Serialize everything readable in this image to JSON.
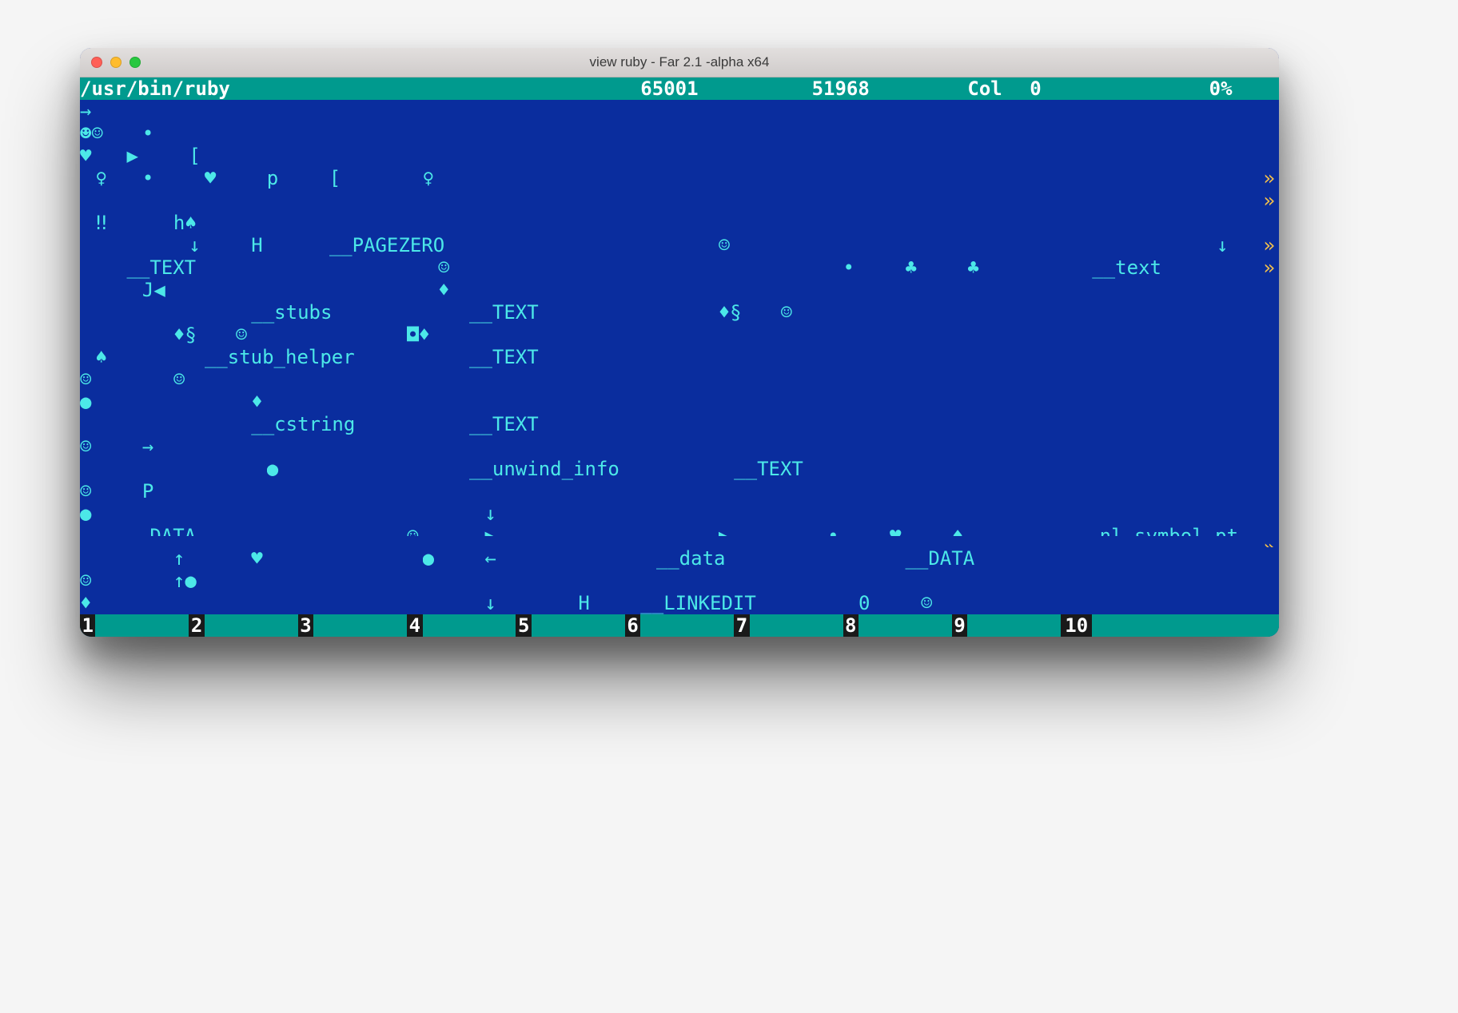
{
  "titlebar": {
    "title": "view ruby - Far 2.1 -alpha x64"
  },
  "header": {
    "path": "/usr/bin/ruby",
    "codepage": "65001",
    "filesize": "51968",
    "col_label": "Col",
    "col_value": "0",
    "percent": "0%"
  },
  "rows": [
    {
      "cells": [
        {
          "c": 0,
          "t": "→"
        }
      ]
    },
    {
      "cells": [
        {
          "c": 0,
          "t": "☻☺"
        },
        {
          "c": 4,
          "t": "•"
        }
      ]
    },
    {
      "cells": [
        {
          "c": 0,
          "t": "♥"
        },
        {
          "c": 3,
          "t": "▶"
        },
        {
          "c": 7,
          "t": "["
        }
      ]
    },
    {
      "cells": [
        {
          "c": 1,
          "t": "♀"
        },
        {
          "c": 4,
          "t": "•"
        },
        {
          "c": 8,
          "t": "♥"
        },
        {
          "c": 12,
          "t": "p"
        },
        {
          "c": 16,
          "t": "["
        },
        {
          "c": 22,
          "t": "♀"
        },
        {
          "c": 76,
          "t": "»",
          "cls": "yellow"
        }
      ]
    },
    {
      "cells": [
        {
          "c": 76,
          "t": "»",
          "cls": "yellow"
        }
      ]
    },
    {
      "cells": [
        {
          "c": 1,
          "t": "‼"
        },
        {
          "c": 6,
          "t": "h♠"
        }
      ]
    },
    {
      "cells": [
        {
          "c": 7,
          "t": "↓"
        },
        {
          "c": 11,
          "t": "H"
        },
        {
          "c": 16,
          "t": "__PAGEZERO"
        },
        {
          "c": 41,
          "t": "☺"
        },
        {
          "c": 73,
          "t": "↓"
        },
        {
          "c": 76,
          "t": "»",
          "cls": "yellow"
        }
      ]
    },
    {
      "cells": [
        {
          "c": 3,
          "t": "__TEXT"
        },
        {
          "c": 23,
          "t": "☺"
        },
        {
          "c": 49,
          "t": "•"
        },
        {
          "c": 53,
          "t": "♣"
        },
        {
          "c": 57,
          "t": "♣"
        },
        {
          "c": 65,
          "t": "__text"
        },
        {
          "c": 76,
          "t": "»",
          "cls": "yellow"
        }
      ]
    },
    {
      "cells": [
        {
          "c": 4,
          "t": "J◀"
        },
        {
          "c": 23,
          "t": "♦"
        }
      ]
    },
    {
      "cells": [
        {
          "c": 11,
          "t": "__stubs"
        },
        {
          "c": 25,
          "t": "__TEXT"
        },
        {
          "c": 41,
          "t": "♦§"
        },
        {
          "c": 45,
          "t": "☺"
        }
      ]
    },
    {
      "cells": [
        {
          "c": 6,
          "t": "♦§"
        },
        {
          "c": 10,
          "t": "☺"
        },
        {
          "c": 21,
          "t": "◘♦"
        }
      ]
    },
    {
      "cells": [
        {
          "c": 1,
          "t": "♠"
        },
        {
          "c": 8,
          "t": "__stub_helper"
        },
        {
          "c": 25,
          "t": "__TEXT"
        }
      ]
    },
    {
      "cells": [
        {
          "c": 0,
          "t": "☺"
        },
        {
          "c": 6,
          "t": "☺"
        }
      ]
    },
    {
      "cells": [
        {
          "c": 0,
          "t": "●"
        },
        {
          "c": 11,
          "t": "♦"
        }
      ]
    },
    {
      "cells": [
        {
          "c": 11,
          "t": "__cstring"
        },
        {
          "c": 25,
          "t": "__TEXT"
        }
      ]
    },
    {
      "cells": [
        {
          "c": 0,
          "t": "☺"
        },
        {
          "c": 4,
          "t": "→"
        }
      ]
    },
    {
      "cells": [
        {
          "c": 12,
          "t": "●"
        },
        {
          "c": 25,
          "t": "__unwind_info"
        },
        {
          "c": 42,
          "t": "__TEXT"
        }
      ]
    },
    {
      "cells": [
        {
          "c": 0,
          "t": "☺"
        },
        {
          "c": 4,
          "t": "P"
        }
      ]
    },
    {
      "cells": [
        {
          "c": 0,
          "t": "●"
        },
        {
          "c": 26,
          "t": "↓"
        }
      ]
    },
    {
      "cells": [
        {
          "c": 3,
          "t": "__DATA"
        },
        {
          "c": 21,
          "t": "☺"
        },
        {
          "c": 26,
          "t": "▶"
        },
        {
          "c": 41,
          "t": "▶"
        },
        {
          "c": 48,
          "t": "•"
        },
        {
          "c": 52,
          "t": "♥"
        },
        {
          "c": 56,
          "t": "♦"
        },
        {
          "c": 64,
          "t": "__nl_symbol_pt"
        },
        {
          "c": 78,
          "t": "»",
          "cls": "yellow",
          "skip": true
        }
      ]
    },
    {
      "cells": [
        {
          "c": 6,
          "t": "↑"
        },
        {
          "c": 11,
          "t": "♥"
        },
        {
          "c": 22,
          "t": "●"
        },
        {
          "c": 26,
          "t": "←"
        },
        {
          "c": 37,
          "t": "__data"
        },
        {
          "c": 53,
          "t": "__DATA"
        }
      ]
    },
    {
      "cells": [
        {
          "c": 0,
          "t": "☺"
        },
        {
          "c": 6,
          "t": "↑●"
        }
      ]
    },
    {
      "cells": [
        {
          "c": 0,
          "t": "♦"
        },
        {
          "c": 26,
          "t": "↓"
        },
        {
          "c": 32,
          "t": "H"
        },
        {
          "c": 36,
          "t": "__LINKEDIT"
        },
        {
          "c": 50,
          "t": "0"
        },
        {
          "c": 54,
          "t": "☺"
        }
      ]
    }
  ],
  "nl_overflow": "»",
  "footer": {
    "keys": [
      "1",
      "2",
      "3",
      "4",
      "5",
      "6",
      "7",
      "8",
      "9",
      "10"
    ]
  }
}
